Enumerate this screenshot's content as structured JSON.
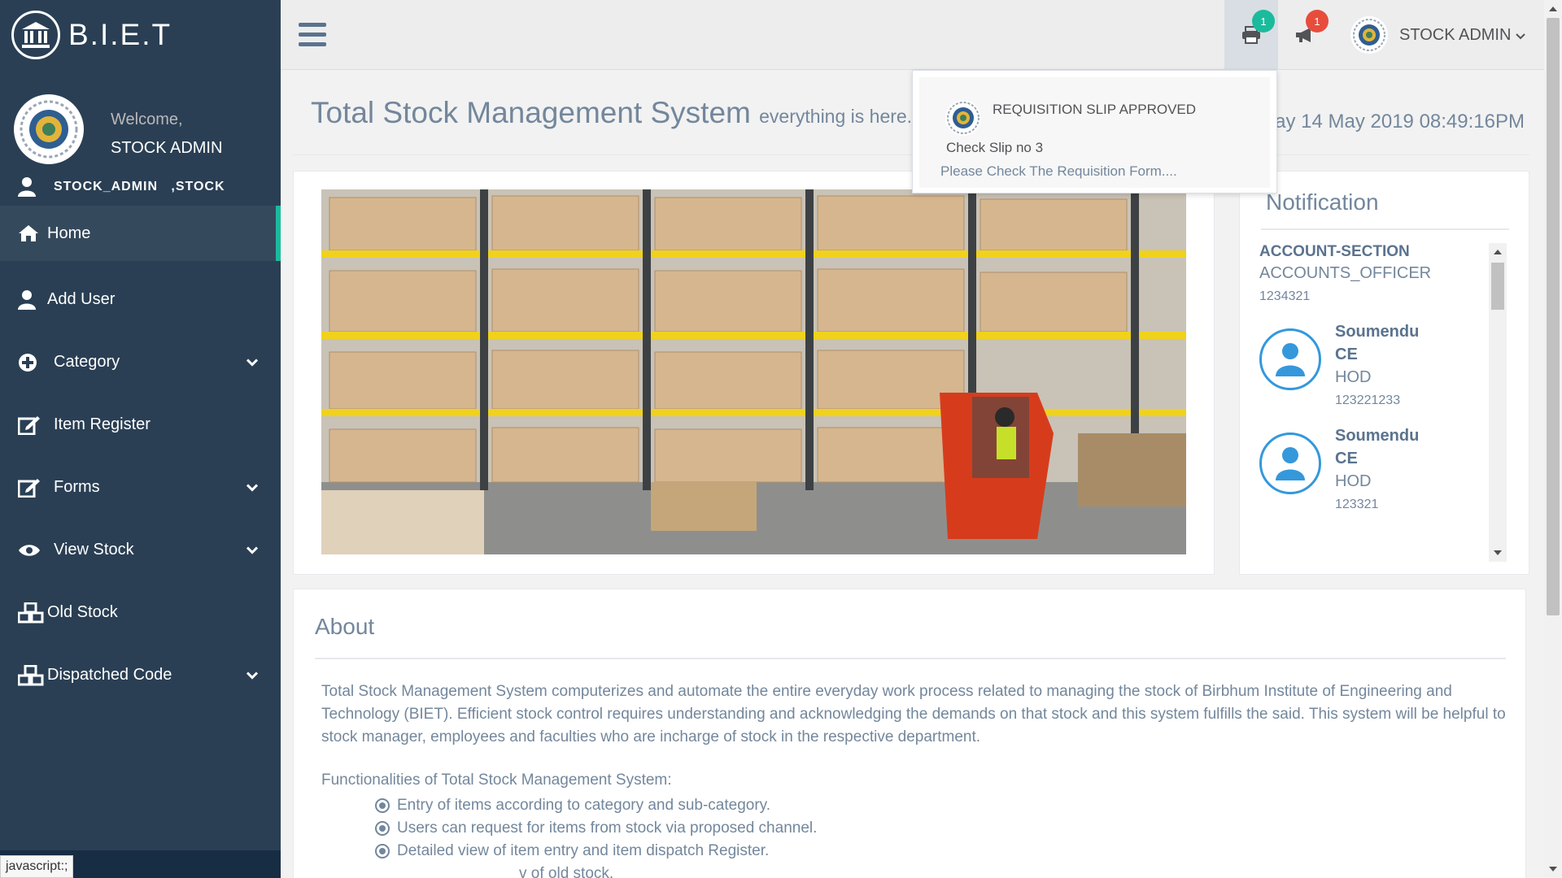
{
  "brand": {
    "title": "B.I.E.T",
    "icon": "bank-icon"
  },
  "profile": {
    "welcome": "Welcome,",
    "name": "STOCK ADMIN",
    "role_line": "STOCK_ADMIN   ,STOCK"
  },
  "sidebar": {
    "items": [
      {
        "label": "Home",
        "icon": "home-icon",
        "expandable": false,
        "active": true
      },
      {
        "label": "Add User",
        "icon": "user-icon",
        "expandable": false
      },
      {
        "label": "Category",
        "icon": "plus-circle-icon",
        "expandable": true
      },
      {
        "label": "Item Register",
        "icon": "edit-icon",
        "expandable": false
      },
      {
        "label": "Forms",
        "icon": "edit-icon",
        "expandable": true
      },
      {
        "label": "View Stock",
        "icon": "eye-icon",
        "expandable": true
      },
      {
        "label": "Old Stock",
        "icon": "cubes-icon",
        "expandable": false
      },
      {
        "label": "Dispatched Code",
        "icon": "cubes-icon",
        "expandable": true
      }
    ]
  },
  "topnav": {
    "print_badge": "1",
    "announce_badge": "1",
    "user_label": "STOCK ADMIN"
  },
  "dropdown": {
    "title": "REQUISITION SLIP APPROVED",
    "slip": "Check Slip no 3",
    "message": "Please Check The Requisition Form...."
  },
  "page": {
    "title": "Total Stock Management System",
    "subtitle": "everything is here...",
    "datetime": "ay 14 May 2019 08:49:16PM"
  },
  "notification": {
    "title": "Notification",
    "account_section": "ACCOUNT-SECTION",
    "account_role": "ACCOUNTS_OFFICER",
    "account_id": "1234321",
    "people": [
      {
        "name1": "Soumendu",
        "name2": "CE",
        "designation": "HOD",
        "id": "123221233"
      },
      {
        "name1": "Soumendu",
        "name2": "CE",
        "designation": "HOD",
        "id": "123321"
      }
    ]
  },
  "about": {
    "title": "About",
    "text": "Total Stock Management System computerizes and automate the entire everyday work process related to managing the stock of Birbhum Institute of Engineering and Technology (BIET). Efficient stock control requires understanding and acknowledging the demands on that stock and this system fulfills the said. This system will be helpful to stock manager, employees and faculties who are incharge of stock in the respective department.",
    "functionalities_title": "Functionalities of Total Stock Management System:",
    "functionalities": [
      "Entry of items according to category and sub-category.",
      "Users can request for items from stock via proposed channel.",
      "Detailed view of item entry and item dispatch Register.",
      "v of old stock."
    ]
  },
  "statusbar": {
    "text": "javascript:;"
  },
  "colors": {
    "sidebar_bg": "#2a3f54",
    "accent": "#1abb9c",
    "badge_red": "#e74c3c",
    "avatar_blue": "#3498db"
  }
}
